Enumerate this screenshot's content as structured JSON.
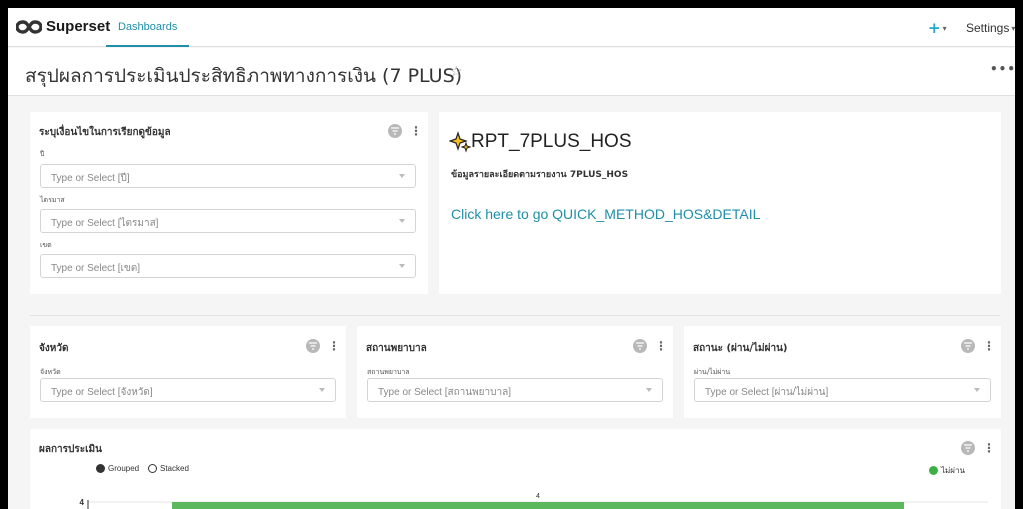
{
  "navbar": {
    "brand": "Superset",
    "tab_dashboards": "Dashboards",
    "plus": "+",
    "settings": "Settings"
  },
  "header": {
    "title": "สรุปผลการประเมินประสิทธิภาพทางการเงิน (7 PLUS)"
  },
  "filter_main": {
    "title": "ระบุเงื่อนไขในการเรียกดูข้อมูล",
    "fields": [
      {
        "label": "ปี",
        "placeholder": "Type or Select [ปี]"
      },
      {
        "label": "ไตรมาส",
        "placeholder": "Type or Select [ไตรมาส]"
      },
      {
        "label": "เขต",
        "placeholder": "Type or Select [เขต]"
      }
    ]
  },
  "markdown": {
    "title": "RPT_7PLUS_HOS",
    "subtitle": "ข้อมูลรายละเอียดตามรายงาน 7PLUS_HOS",
    "link": "Click here to go QUICK_METHOD_HOS&DETAIL"
  },
  "filter_province": {
    "title": "จังหวัด",
    "label": "จังหวัด",
    "placeholder": "Type or Select [จังหวัด]"
  },
  "filter_hospital": {
    "title": "สถานพยาบาล",
    "label": "สถานพยาบาล",
    "placeholder": "Type or Select [สถานพยาบาล]"
  },
  "filter_status": {
    "title": "สถานะ (ผ่าน/ไม่ผ่าน)",
    "label": "ผ่าน/ไม่ผ่าน",
    "placeholder": "Type or Select [ผ่าน/ไม่ผ่าน]"
  },
  "result_chart": {
    "title": "ผลการประเมิน",
    "control_grouped": "Grouped",
    "control_stacked": "Stacked"
  },
  "colors": {
    "accent": "#1f8ea8",
    "bar_green": "#5cb85c"
  },
  "chart_data": {
    "type": "bar",
    "categories": [
      ""
    ],
    "series": [
      {
        "name": "ไม่ผ่าน",
        "values": [
          4
        ]
      }
    ],
    "yticks": [
      "4"
    ],
    "data_labels": [
      "4"
    ],
    "legend_position": "top-right"
  }
}
